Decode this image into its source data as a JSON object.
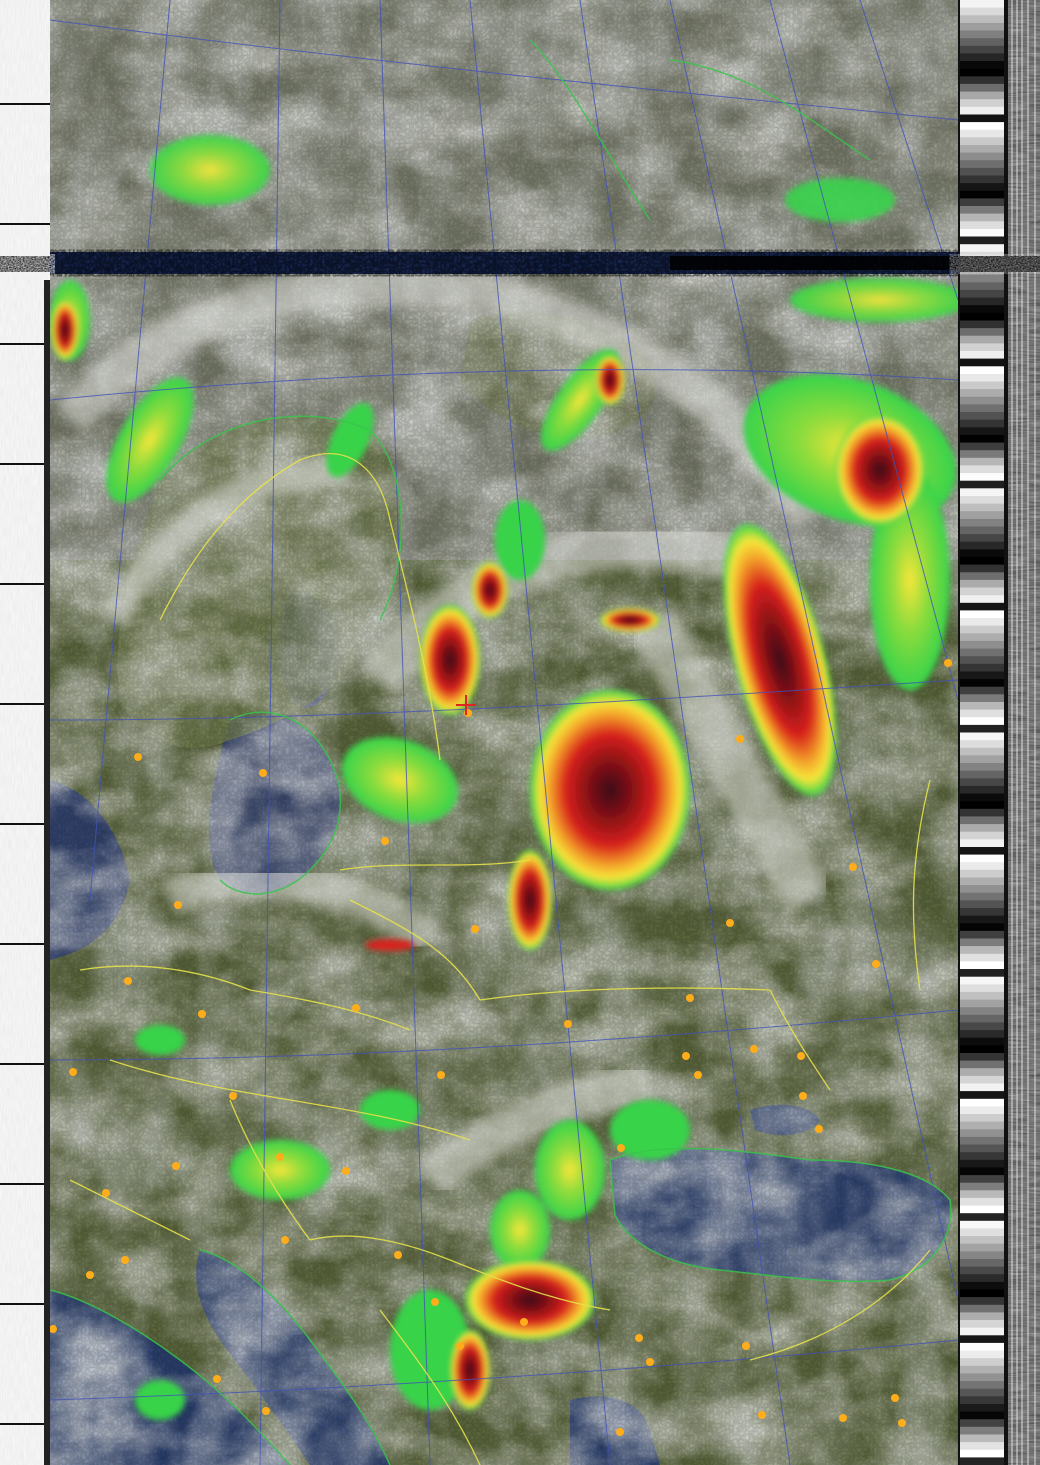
{
  "image": {
    "kind": "satellite-weather-image",
    "palette": {
      "land": "#5f6b3f",
      "land_dark": "#434a2c",
      "sea": "#2b3f6c",
      "cloud_low": "#c9cbc6",
      "cloud_mid": "#9fa39c",
      "precip_green": "#37d34a",
      "precip_yellow": "#f6e63a",
      "precip_red": "#d6201b",
      "precip_dark": "#4a0a10",
      "border_yellow": "#e6e24a",
      "grid_blue": "#4152b8",
      "city_orange": "#ffad1a"
    },
    "telemetry_bars": 12,
    "features": {
      "cities": 48,
      "marker": "red-cross"
    }
  }
}
